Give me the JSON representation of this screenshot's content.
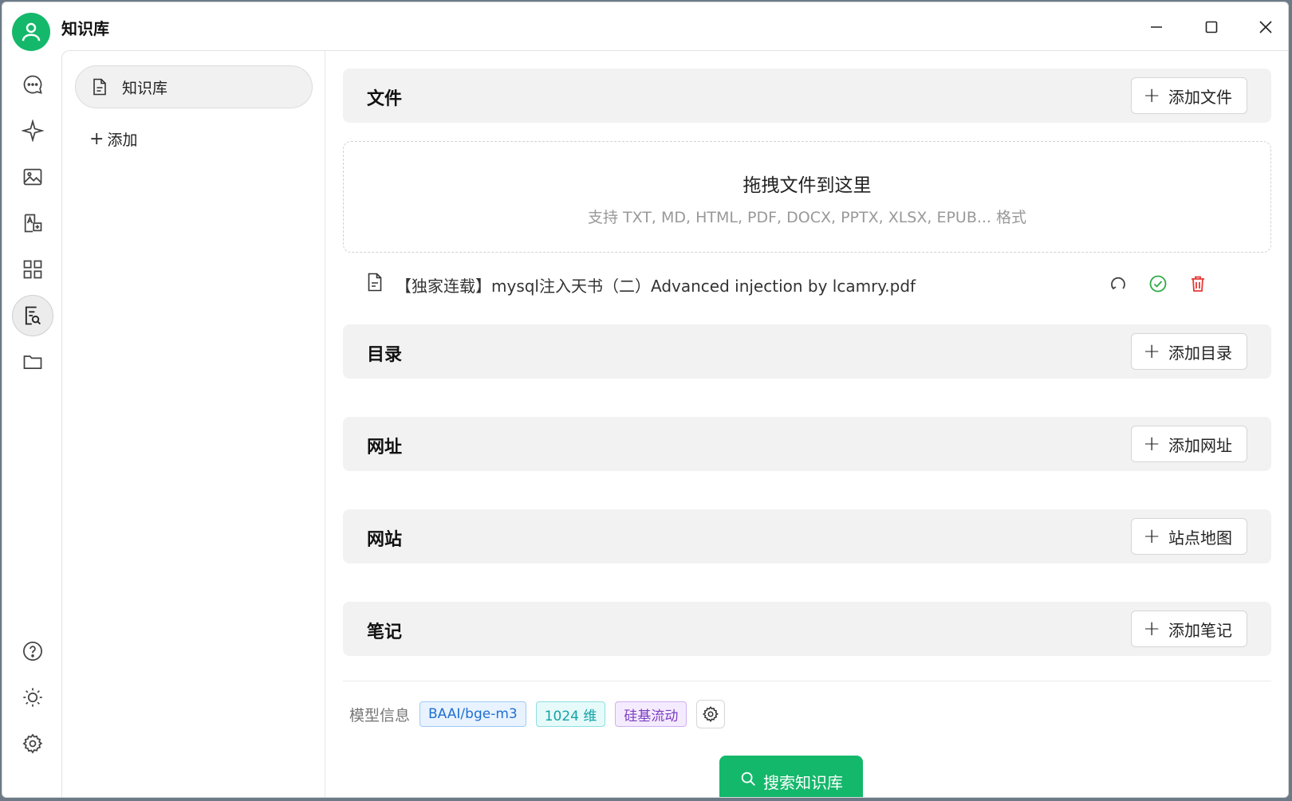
{
  "window": {
    "title": "知识库"
  },
  "sidebar": {
    "kb_items": [
      {
        "label": "知识库"
      }
    ],
    "add_label": "添加"
  },
  "sections": {
    "files": {
      "title": "文件",
      "button": "添加文件"
    },
    "directory": {
      "title": "目录",
      "button": "添加目录"
    },
    "urls": {
      "title": "网址",
      "button": "添加网址"
    },
    "website": {
      "title": "网站",
      "button": "站点地图"
    },
    "notes": {
      "title": "笔记",
      "button": "添加笔记"
    }
  },
  "dropzone": {
    "title": "拖拽文件到这里",
    "hint": "支持 TXT, MD, HTML, PDF, DOCX, PPTX, XLSX, EPUB... 格式"
  },
  "files": [
    {
      "name": "【独家连载】mysql注入天书（二）Advanced injection by lcamry.pdf"
    }
  ],
  "model": {
    "label": "模型信息",
    "name": "BAAI/bge-m3",
    "dims": "1024 维",
    "provider": "硅基流动"
  },
  "search_button": "搜索知识库",
  "colors": {
    "accent": "#14b86b",
    "delete": "#e53935",
    "success": "#2faa47"
  }
}
